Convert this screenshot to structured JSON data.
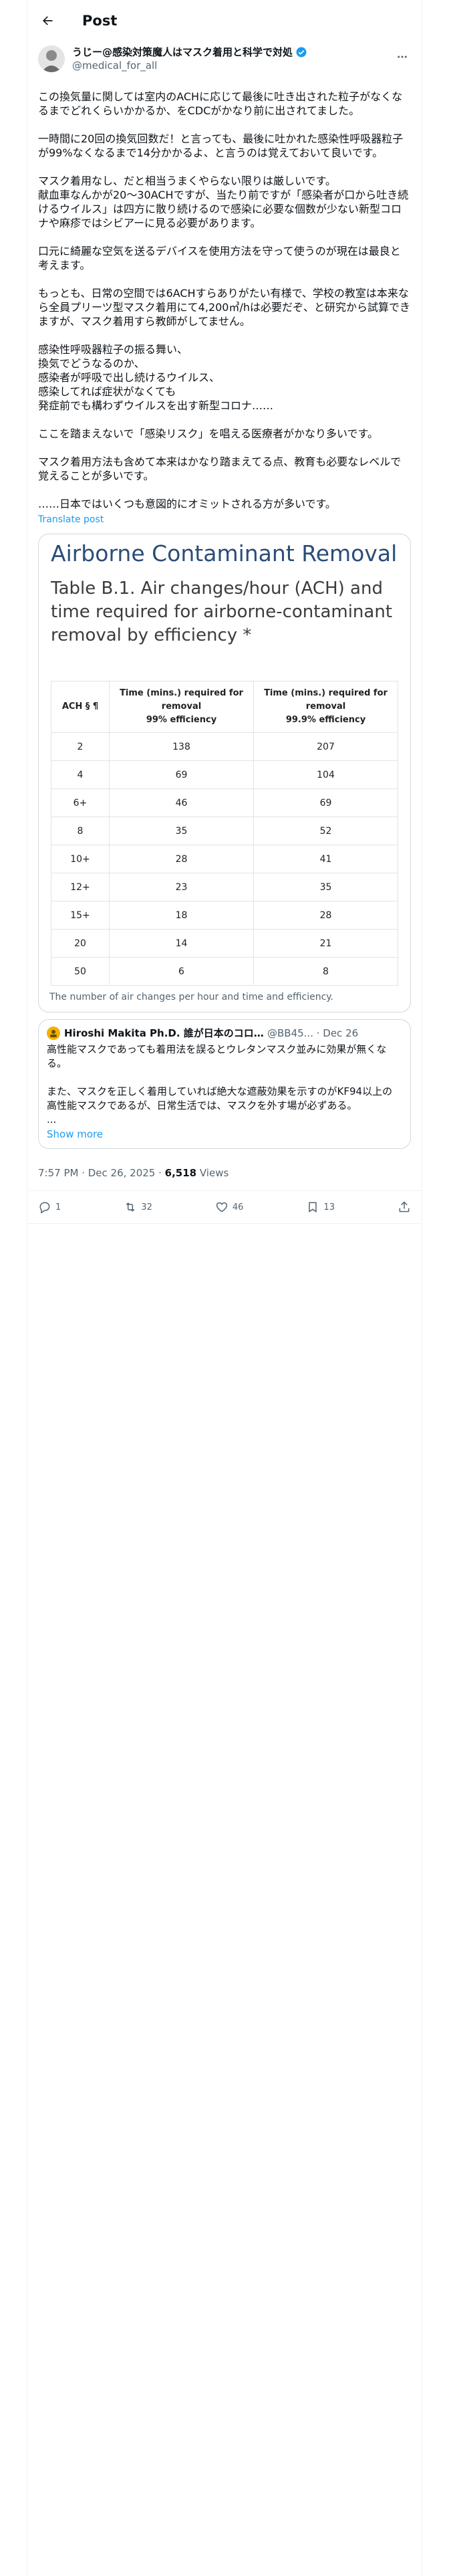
{
  "header": {
    "title": "Post"
  },
  "author": {
    "name": "うじー@感染対策魔人はマスク着用と科学で対処",
    "handle": "@medical_for_all"
  },
  "post": {
    "paragraphs": [
      "この換気量に関しては室内のACHに応じて最後に吐き出された粒子がなくなるまでどれくらいかかるか、をCDCがかなり前に出されてました。",
      "一時間に20回の換気回数だ！と言っても、最後に吐かれた感染性呼吸器粒子が99%なくなるまで14分かかるよ、と言うのは覚えておいて良いです。",
      "マスク着用なし、だと相当うまくやらない限りは厳しいです。\n献血車なんかが20〜30ACHですが、当たり前ですが「感染者が口から吐き続けるウイルス」は四方に散り続けるので感染に必要な個数が少ない新型コロナや麻疹ではシビアーに見る必要があります。",
      "口元に綺麗な空気を送るデバイスを使用方法を守って使うのが現在は最良と考えます。",
      "もっとも、日常の空間では6ACHすらありがたい有様で、学校の教室は本来なら全員プリーツ型マスク着用にて4,200㎥/hは必要だぞ、と研究から試算できますが、マスク着用すら教師がしてません。",
      "感染性呼吸器粒子の振る舞い、\n換気でどうなるのか、\n感染者が呼吸で出し続けるウイルス、\n感染してれば症状がなくても\n発症前でも構わずウイルスを出す新型コロナ……",
      "ここを踏まえないで「感染リスク」を唱える医療者がかなり多いです。",
      "マスク着用方法も含めて本来はかなり踏まえてる点、教育も必要なレベルで覚えることが多いです。",
      "……日本ではいくつも意図的にオミットされる方が多いです。"
    ],
    "translate_label": "Translate post"
  },
  "media": {
    "heading": "Airborne Contaminant Removal",
    "subtitle": "Table B.1. Air changes/hour (ACH) and time required for airborne-contaminant removal by efficiency *",
    "columns": [
      "ACH § ¶",
      "Time (mins.) required for removal\n99% efficiency",
      "Time (mins.) required for removal\n99.9% efficiency"
    ],
    "rows": [
      [
        "2",
        "138",
        "207"
      ],
      [
        "4",
        "69",
        "104"
      ],
      [
        "6+",
        "46",
        "69"
      ],
      [
        "8",
        "35",
        "52"
      ],
      [
        "10+",
        "28",
        "41"
      ],
      [
        "12+",
        "23",
        "35"
      ],
      [
        "15+",
        "18",
        "28"
      ],
      [
        "20",
        "14",
        "21"
      ],
      [
        "50",
        "6",
        "8"
      ]
    ],
    "caption": "The number of air changes per hour and time and efficiency."
  },
  "quote": {
    "name": "Hiroshi Makita Ph.D. 誰が日本のコロナ禍を悪化させ...",
    "handle": "@BB45... · Dec 26",
    "text": "高性能マスクであっても着用法を誤るとウレタンマスク並みに効果が無くなる。\n\nまた、マスクを正しく着用していれば絶大な遮蔽効果を示すのがKF94以上の高性能マスクであるが、日常生活では、マスクを外す場が必ずある。\n...",
    "show_more": "Show more"
  },
  "meta": {
    "time": "7:57 PM · Dec 26, 2025 · ",
    "views_count": "6,518",
    "views_label": " Views"
  },
  "actions": {
    "replies": "1",
    "reposts": "32",
    "likes": "46",
    "bookmarks": "13"
  },
  "colors": {
    "accent": "#1d9bf0",
    "heading": "#2a4d78"
  }
}
